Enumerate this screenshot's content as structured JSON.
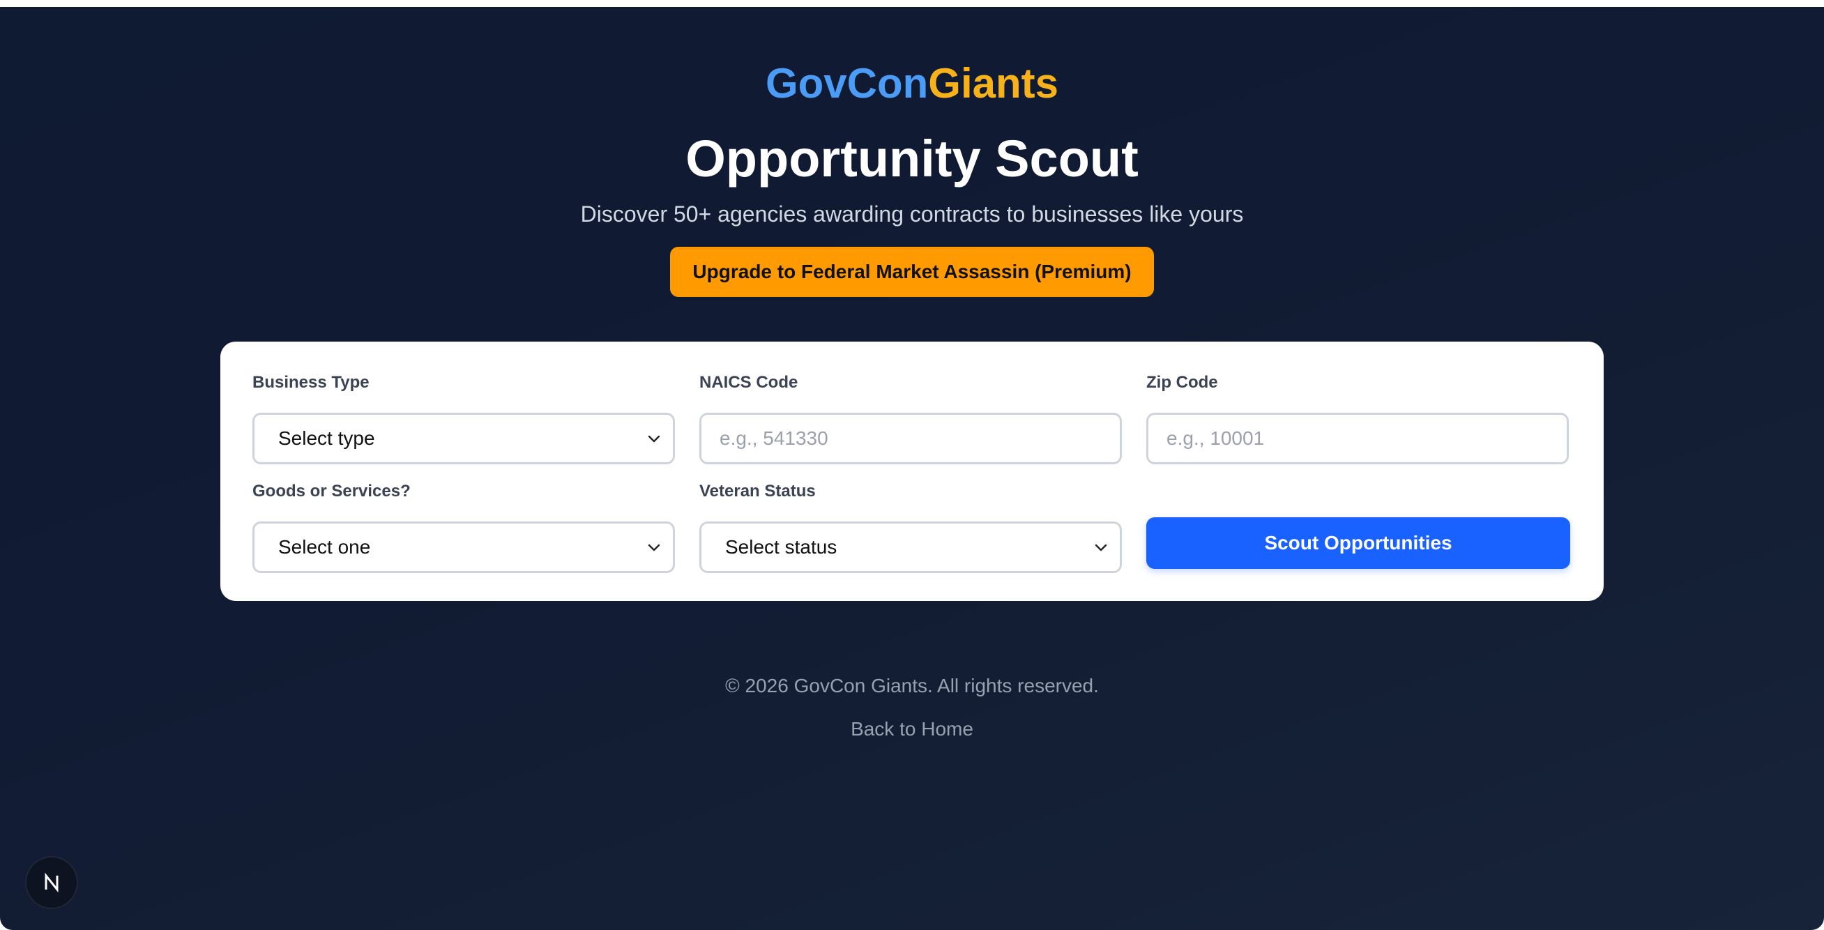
{
  "brand": {
    "part1": "GovCon",
    "part2": "Giants"
  },
  "hero": {
    "title": "Opportunity Scout",
    "subtitle": "Discover 50+ agencies awarding contracts to businesses like yours",
    "upgrade_label": "Upgrade to Federal Market Assassin (Premium)"
  },
  "form": {
    "business_type": {
      "label": "Business Type",
      "value": "Select type"
    },
    "naics": {
      "label": "NAICS Code",
      "placeholder": "e.g., 541330"
    },
    "zip": {
      "label": "Zip Code",
      "placeholder": "e.g., 10001"
    },
    "goods_services": {
      "label": "Goods or Services?",
      "value": "Select one"
    },
    "veteran": {
      "label": "Veteran Status",
      "value": "Select status"
    },
    "submit_label": "Scout Opportunities"
  },
  "footer": {
    "copyright": "© 2026 GovCon Giants. All rights reserved.",
    "back_link": "Back to Home"
  },
  "badge": {
    "letter": "N",
    "icon": "nextjs-icon"
  },
  "colors": {
    "background": "#111b33",
    "brand_blue": "#4a9cf6",
    "brand_gold": "#f7b21b",
    "upgrade_orange": "#ff9a00",
    "primary_blue": "#1a62ff"
  }
}
